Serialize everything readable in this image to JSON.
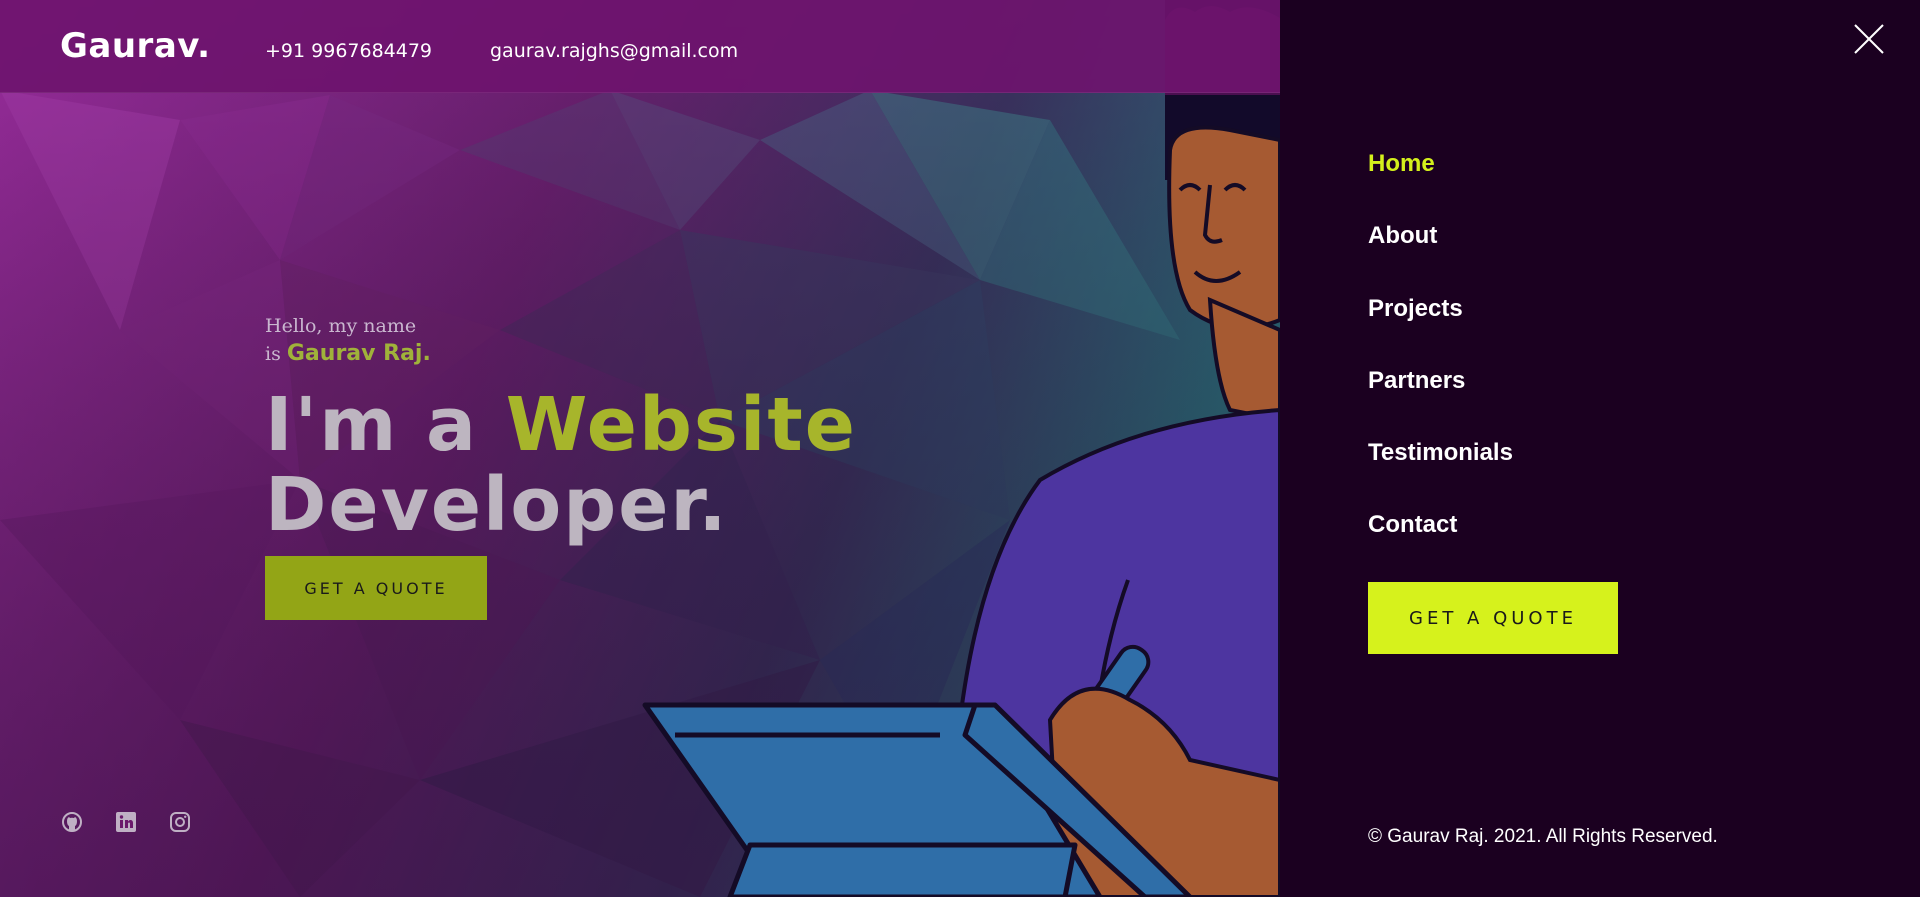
{
  "header": {
    "brand": "Gaurav.",
    "phone": "+91 9967684479",
    "email": "gaurav.rajghs@gmail.com"
  },
  "hero": {
    "greeting_line1": "Hello, my name",
    "greeting_line2_prefix": "is",
    "name": "Gaurav Raj.",
    "headline_prefix": "I'm a",
    "headline_highlight": "Website",
    "headline_line2": "Developer.",
    "cta_label": "GET A QUOTE"
  },
  "social": [
    {
      "icon": "github-icon"
    },
    {
      "icon": "linkedin-icon"
    },
    {
      "icon": "instagram-icon"
    }
  ],
  "menu": {
    "items": [
      {
        "label": "Home",
        "active": true
      },
      {
        "label": "About",
        "active": false
      },
      {
        "label": "Projects",
        "active": false
      },
      {
        "label": "Partners",
        "active": false
      },
      {
        "label": "Testimonials",
        "active": false
      },
      {
        "label": "Contact",
        "active": false
      }
    ],
    "cta_label": "GET A QUOTE",
    "copyright": "© Gaurav Raj. 2021. All Rights Reserved."
  },
  "colors": {
    "accent": "#d6f21c",
    "accent_dim": "#93a516",
    "panel_bg": "#1b0020",
    "hero_purple": "#6b1a6b"
  }
}
